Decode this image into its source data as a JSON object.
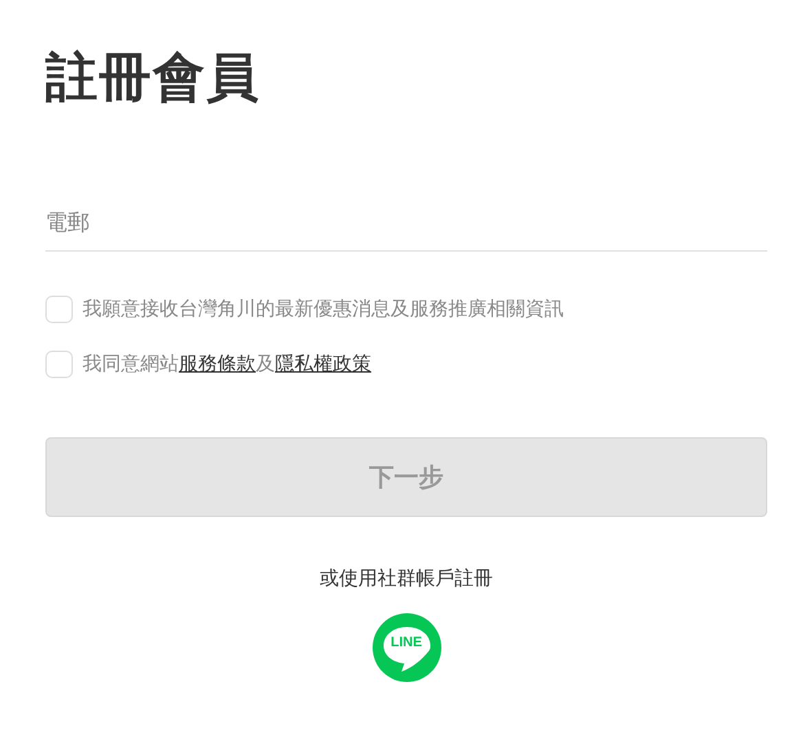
{
  "title": "註冊會員",
  "email_field": {
    "placeholder": "電郵"
  },
  "consents": [
    {
      "checked": false,
      "parts": [
        {
          "kind": "text",
          "text": "我願意接收台灣角川的最新優惠消息及服務推廣相關資訊"
        }
      ]
    },
    {
      "checked": false,
      "parts": [
        {
          "kind": "text",
          "text": "我同意網站"
        },
        {
          "kind": "link",
          "text": "服務條款"
        },
        {
          "kind": "text",
          "text": "及"
        },
        {
          "kind": "link",
          "text": "隱私權政策"
        }
      ]
    }
  ],
  "next_button": {
    "label": "下一步",
    "disabled": true
  },
  "social": {
    "caption": "或使用社群帳戶註冊",
    "line_label": "LINE"
  }
}
